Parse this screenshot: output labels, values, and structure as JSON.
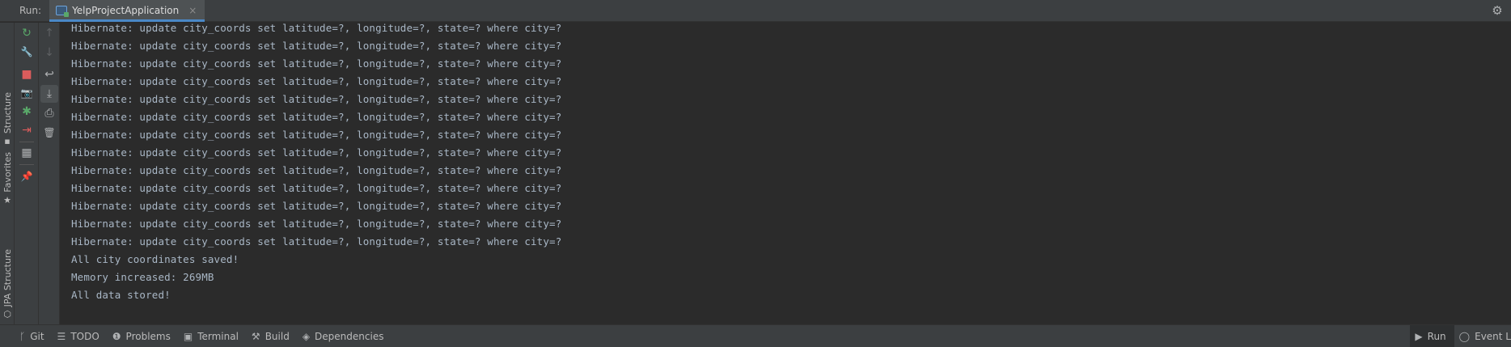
{
  "header": {
    "run_label": "Run:",
    "tab_title": "YelpProjectApplication",
    "tab_close": "×",
    "app_icon": "spring-app-icon",
    "settings_icon": "gear-icon",
    "settings_glyph": "⚙"
  },
  "left_strip": {
    "items": [
      {
        "label": "Structure",
        "icon": "structure-icon",
        "glyph": "▪"
      },
      {
        "label": "Favorites",
        "icon": "star-icon",
        "glyph": "★"
      },
      {
        "label": "JPA Structure",
        "icon": "jpa-icon",
        "glyph": "⬡"
      }
    ]
  },
  "toolbar1": {
    "rerun": {
      "icon": "rerun-icon",
      "glyph": "↻",
      "color": "#59a869"
    },
    "modify": {
      "icon": "wrench-icon",
      "glyph": "🔧"
    },
    "stop": {
      "icon": "stop-icon",
      "glyph": "■",
      "color": "#db5c5c"
    },
    "dump": {
      "icon": "camera-icon",
      "glyph": "📷"
    },
    "debug": {
      "icon": "debug-bug-icon",
      "glyph": "✱",
      "color": "#59a869"
    },
    "exit": {
      "icon": "exit-icon",
      "glyph": "⇥",
      "color": "#db5c5c"
    },
    "layout": {
      "icon": "layout-icon",
      "glyph": "▦"
    },
    "pin": {
      "icon": "pin-icon",
      "glyph": "📌"
    }
  },
  "toolbar2": {
    "up": {
      "icon": "arrow-up-icon",
      "glyph": "↑"
    },
    "down": {
      "icon": "arrow-down-icon",
      "glyph": "↓"
    },
    "wrap": {
      "icon": "soft-wrap-icon",
      "glyph": "↩"
    },
    "scroll_end": {
      "icon": "scroll-to-end-icon",
      "glyph": "⤓"
    },
    "print": {
      "icon": "print-icon",
      "glyph": "⎙"
    },
    "clear": {
      "icon": "trash-icon",
      "glyph": "🗑"
    }
  },
  "console": {
    "lines": [
      "Hibernate: update city_coords set latitude=?, longitude=?, state=? where city=?",
      "Hibernate: update city_coords set latitude=?, longitude=?, state=? where city=?",
      "Hibernate: update city_coords set latitude=?, longitude=?, state=? where city=?",
      "Hibernate: update city_coords set latitude=?, longitude=?, state=? where city=?",
      "Hibernate: update city_coords set latitude=?, longitude=?, state=? where city=?",
      "Hibernate: update city_coords set latitude=?, longitude=?, state=? where city=?",
      "Hibernate: update city_coords set latitude=?, longitude=?, state=? where city=?",
      "Hibernate: update city_coords set latitude=?, longitude=?, state=? where city=?",
      "Hibernate: update city_coords set latitude=?, longitude=?, state=? where city=?",
      "Hibernate: update city_coords set latitude=?, longitude=?, state=? where city=?",
      "Hibernate: update city_coords set latitude=?, longitude=?, state=? where city=?",
      "Hibernate: update city_coords set latitude=?, longitude=?, state=? where city=?",
      "Hibernate: update city_coords set latitude=?, longitude=?, state=? where city=?",
      "All city coordinates saved!",
      "Memory increased: 269MB",
      "All data stored!"
    ]
  },
  "status_bar": {
    "items": [
      {
        "label": "Git",
        "icon": "git-branch-icon",
        "glyph": "ᚴ"
      },
      {
        "label": "TODO",
        "icon": "todo-list-icon",
        "glyph": "☰"
      },
      {
        "label": "Problems",
        "icon": "problems-icon",
        "glyph": "❶"
      },
      {
        "label": "Terminal",
        "icon": "terminal-icon",
        "glyph": "▣"
      },
      {
        "label": "Build",
        "icon": "hammer-icon",
        "glyph": "⚒"
      },
      {
        "label": "Dependencies",
        "icon": "dependencies-icon",
        "glyph": "◈"
      }
    ],
    "right_items": [
      {
        "label": "Run",
        "icon": "run-play-icon",
        "glyph": "▶"
      },
      {
        "label": "Event L",
        "icon": "event-log-icon",
        "glyph": "◯"
      }
    ]
  },
  "colors": {
    "console_bg": "#2b2b2b",
    "panel_bg": "#3c3f41",
    "console_text": "#a9b7c6",
    "tab_underline": "#4a88c7"
  }
}
